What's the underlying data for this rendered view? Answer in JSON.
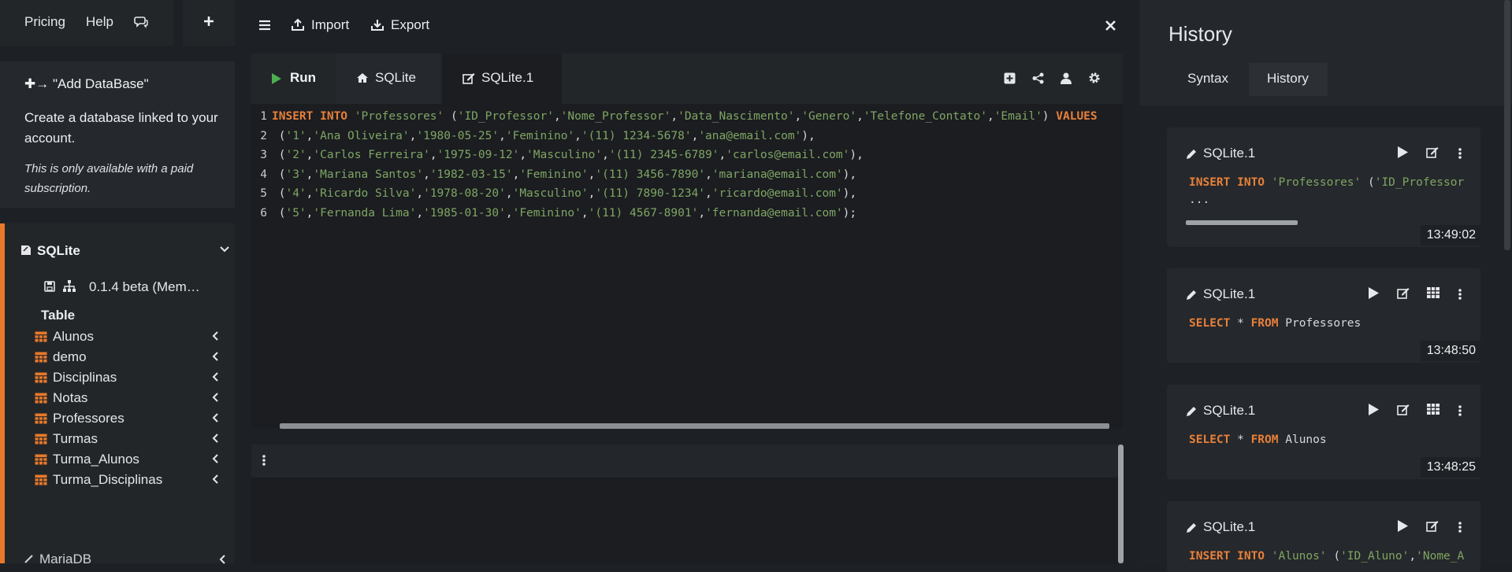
{
  "nav": {
    "pricing": "Pricing",
    "help": "Help",
    "chat_icon": "chat-icon",
    "add_icon": "plus-icon"
  },
  "add_db": {
    "title": "✚→ \"Add DataBase\"",
    "desc": "Create a database linked to your account.",
    "note": "This is only available with a paid subscription."
  },
  "db": {
    "name": "SQLite",
    "version": "0.1.4 beta (Mem…",
    "table_header": "Table",
    "tables": [
      "Alunos",
      "demo",
      "Disciplinas",
      "Notas",
      "Professores",
      "Turmas",
      "Turma_Alunos",
      "Turma_Disciplinas"
    ],
    "next_db": "MariaDB"
  },
  "toolbar": {
    "import": "Import",
    "export": "Export"
  },
  "tabs": {
    "run": "Run",
    "sqlite": "SQLite",
    "sqlite1": "SQLite.1"
  },
  "editor": {
    "lines": [
      {
        "n": "1",
        "tokens": [
          [
            "kw",
            "INSERT INTO "
          ],
          [
            "str",
            "'Professores' "
          ],
          [
            "pl",
            "("
          ],
          [
            "str",
            "'ID_Professor'"
          ],
          [
            "pl",
            ","
          ],
          [
            "str",
            "'Nome_Professor'"
          ],
          [
            "pl",
            ","
          ],
          [
            "str",
            "'Data_Nascimento'"
          ],
          [
            "pl",
            ","
          ],
          [
            "str",
            "'Genero'"
          ],
          [
            "pl",
            ","
          ],
          [
            "str",
            "'Telefone_Contato'"
          ],
          [
            "pl",
            ","
          ],
          [
            "str",
            "'Email'"
          ],
          [
            "pl",
            ") "
          ],
          [
            "kw",
            "VALUES"
          ]
        ]
      },
      {
        "n": "2",
        "tokens": [
          [
            "pl",
            " ("
          ],
          [
            "str",
            "'1'"
          ],
          [
            "pl",
            ","
          ],
          [
            "str",
            "'Ana Oliveira'"
          ],
          [
            "pl",
            ","
          ],
          [
            "str",
            "'1980-05-25'"
          ],
          [
            "pl",
            ","
          ],
          [
            "str",
            "'Feminino'"
          ],
          [
            "pl",
            ","
          ],
          [
            "str",
            "'(11) 1234-5678'"
          ],
          [
            "pl",
            ","
          ],
          [
            "str",
            "'ana@email.com'"
          ],
          [
            "pl",
            "),"
          ]
        ]
      },
      {
        "n": "3",
        "tokens": [
          [
            "pl",
            " ("
          ],
          [
            "str",
            "'2'"
          ],
          [
            "pl",
            ","
          ],
          [
            "str",
            "'Carlos Ferreira'"
          ],
          [
            "pl",
            ","
          ],
          [
            "str",
            "'1975-09-12'"
          ],
          [
            "pl",
            ","
          ],
          [
            "str",
            "'Masculino'"
          ],
          [
            "pl",
            ","
          ],
          [
            "str",
            "'(11) 2345-6789'"
          ],
          [
            "pl",
            ","
          ],
          [
            "str",
            "'carlos@email.com'"
          ],
          [
            "pl",
            "),"
          ]
        ]
      },
      {
        "n": "4",
        "tokens": [
          [
            "pl",
            " ("
          ],
          [
            "str",
            "'3'"
          ],
          [
            "pl",
            ","
          ],
          [
            "str",
            "'Mariana Santos'"
          ],
          [
            "pl",
            ","
          ],
          [
            "str",
            "'1982-03-15'"
          ],
          [
            "pl",
            ","
          ],
          [
            "str",
            "'Feminino'"
          ],
          [
            "pl",
            ","
          ],
          [
            "str",
            "'(11) 3456-7890'"
          ],
          [
            "pl",
            ","
          ],
          [
            "str",
            "'mariana@email.com'"
          ],
          [
            "pl",
            "),"
          ]
        ]
      },
      {
        "n": "5",
        "tokens": [
          [
            "pl",
            " ("
          ],
          [
            "str",
            "'4'"
          ],
          [
            "pl",
            ","
          ],
          [
            "str",
            "'Ricardo Silva'"
          ],
          [
            "pl",
            ","
          ],
          [
            "str",
            "'1978-08-20'"
          ],
          [
            "pl",
            ","
          ],
          [
            "str",
            "'Masculino'"
          ],
          [
            "pl",
            ","
          ],
          [
            "str",
            "'(11) 7890-1234'"
          ],
          [
            "pl",
            ","
          ],
          [
            "str",
            "'ricardo@email.com'"
          ],
          [
            "pl",
            "),"
          ]
        ]
      },
      {
        "n": "6",
        "tokens": [
          [
            "pl",
            " ("
          ],
          [
            "str",
            "'5'"
          ],
          [
            "pl",
            ","
          ],
          [
            "str",
            "'Fernanda Lima'"
          ],
          [
            "pl",
            ","
          ],
          [
            "str",
            "'1985-01-30'"
          ],
          [
            "pl",
            ","
          ],
          [
            "str",
            "'Feminino'"
          ],
          [
            "pl",
            ","
          ],
          [
            "str",
            "'(11) 4567-8901'"
          ],
          [
            "pl",
            ","
          ],
          [
            "str",
            "'fernanda@email.com'"
          ],
          [
            "pl",
            ");"
          ]
        ]
      }
    ]
  },
  "history": {
    "title": "History",
    "tabs": [
      "Syntax",
      "History"
    ],
    "items": [
      {
        "db": "SQLite.1",
        "time": "13:49:02",
        "q1": [
          [
            "kw",
            "INSERT INTO "
          ],
          [
            "str",
            "'Professores' "
          ],
          [
            "pl",
            "("
          ],
          [
            "str",
            "'ID_Professor"
          ]
        ],
        "q2": "...",
        "table_icon": false
      },
      {
        "db": "SQLite.1",
        "time": "13:48:50",
        "q1": [
          [
            "kw",
            "SELECT "
          ],
          [
            "pl",
            "* "
          ],
          [
            "kw",
            "FROM "
          ],
          [
            "pl",
            "Professores"
          ]
        ],
        "q2": "",
        "table_icon": true
      },
      {
        "db": "SQLite.1",
        "time": "13:48:25",
        "q1": [
          [
            "kw",
            "SELECT "
          ],
          [
            "pl",
            "* "
          ],
          [
            "kw",
            "FROM "
          ],
          [
            "pl",
            "Alunos"
          ]
        ],
        "q2": "",
        "table_icon": true
      },
      {
        "db": "SQLite.1",
        "time": "",
        "q1": [
          [
            "kw",
            "INSERT INTO "
          ],
          [
            "str",
            "'Alunos' "
          ],
          [
            "pl",
            "("
          ],
          [
            "str",
            "'ID_Aluno'"
          ],
          [
            "pl",
            ","
          ],
          [
            "str",
            "'Nome_A"
          ]
        ],
        "q2": "",
        "table_icon": false
      }
    ]
  },
  "colors": {
    "accent": "#e8792b",
    "run_green": "#4caf50",
    "keyword": "#e8803a",
    "string": "#7fa563"
  }
}
